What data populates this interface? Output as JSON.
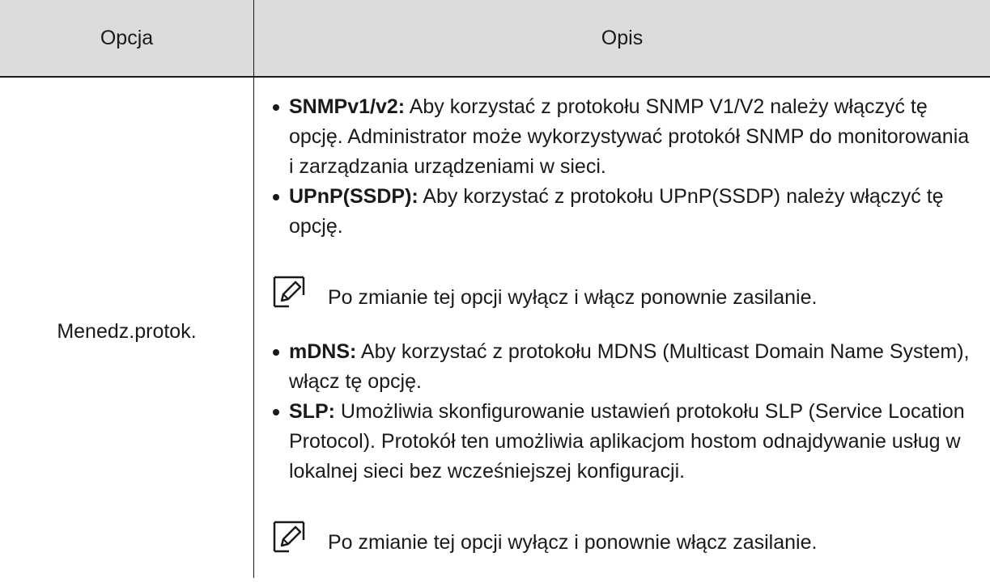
{
  "header": {
    "col1": "Opcja",
    "col2": "Opis"
  },
  "row": {
    "option": "Menedz.protok.",
    "items_a": [
      {
        "term": "SNMPv1/v2:",
        "text": " Aby korzystać z protokołu SNMP V1/V2 należy włączyć tę opcję. Administrator może wykorzystywać protokół SNMP do monitorowania i zarządzania urządzeniami w sieci."
      },
      {
        "term": "UPnP(SSDP):",
        "text": " Aby korzystać z protokołu UPnP(SSDP) należy włączyć tę opcję."
      }
    ],
    "note_a": "Po zmianie tej opcji wyłącz i włącz ponownie zasilanie.",
    "items_b": [
      {
        "term": "mDNS:",
        "text": " Aby korzystać z protokołu MDNS (Multicast Domain Name System), włącz tę opcję."
      },
      {
        "term": "SLP:",
        "text": " Umożliwia skonfigurowanie ustawień protokołu SLP (Service Location Protocol). Protokół ten umożliwia aplikacjom hostom odnajdywanie usług w lokalnej sieci bez wcześniejszej konfiguracji."
      }
    ],
    "note_b": "Po zmianie tej opcji wyłącz i ponownie włącz zasilanie."
  },
  "icons": {
    "note": "note-pencil-icon"
  }
}
